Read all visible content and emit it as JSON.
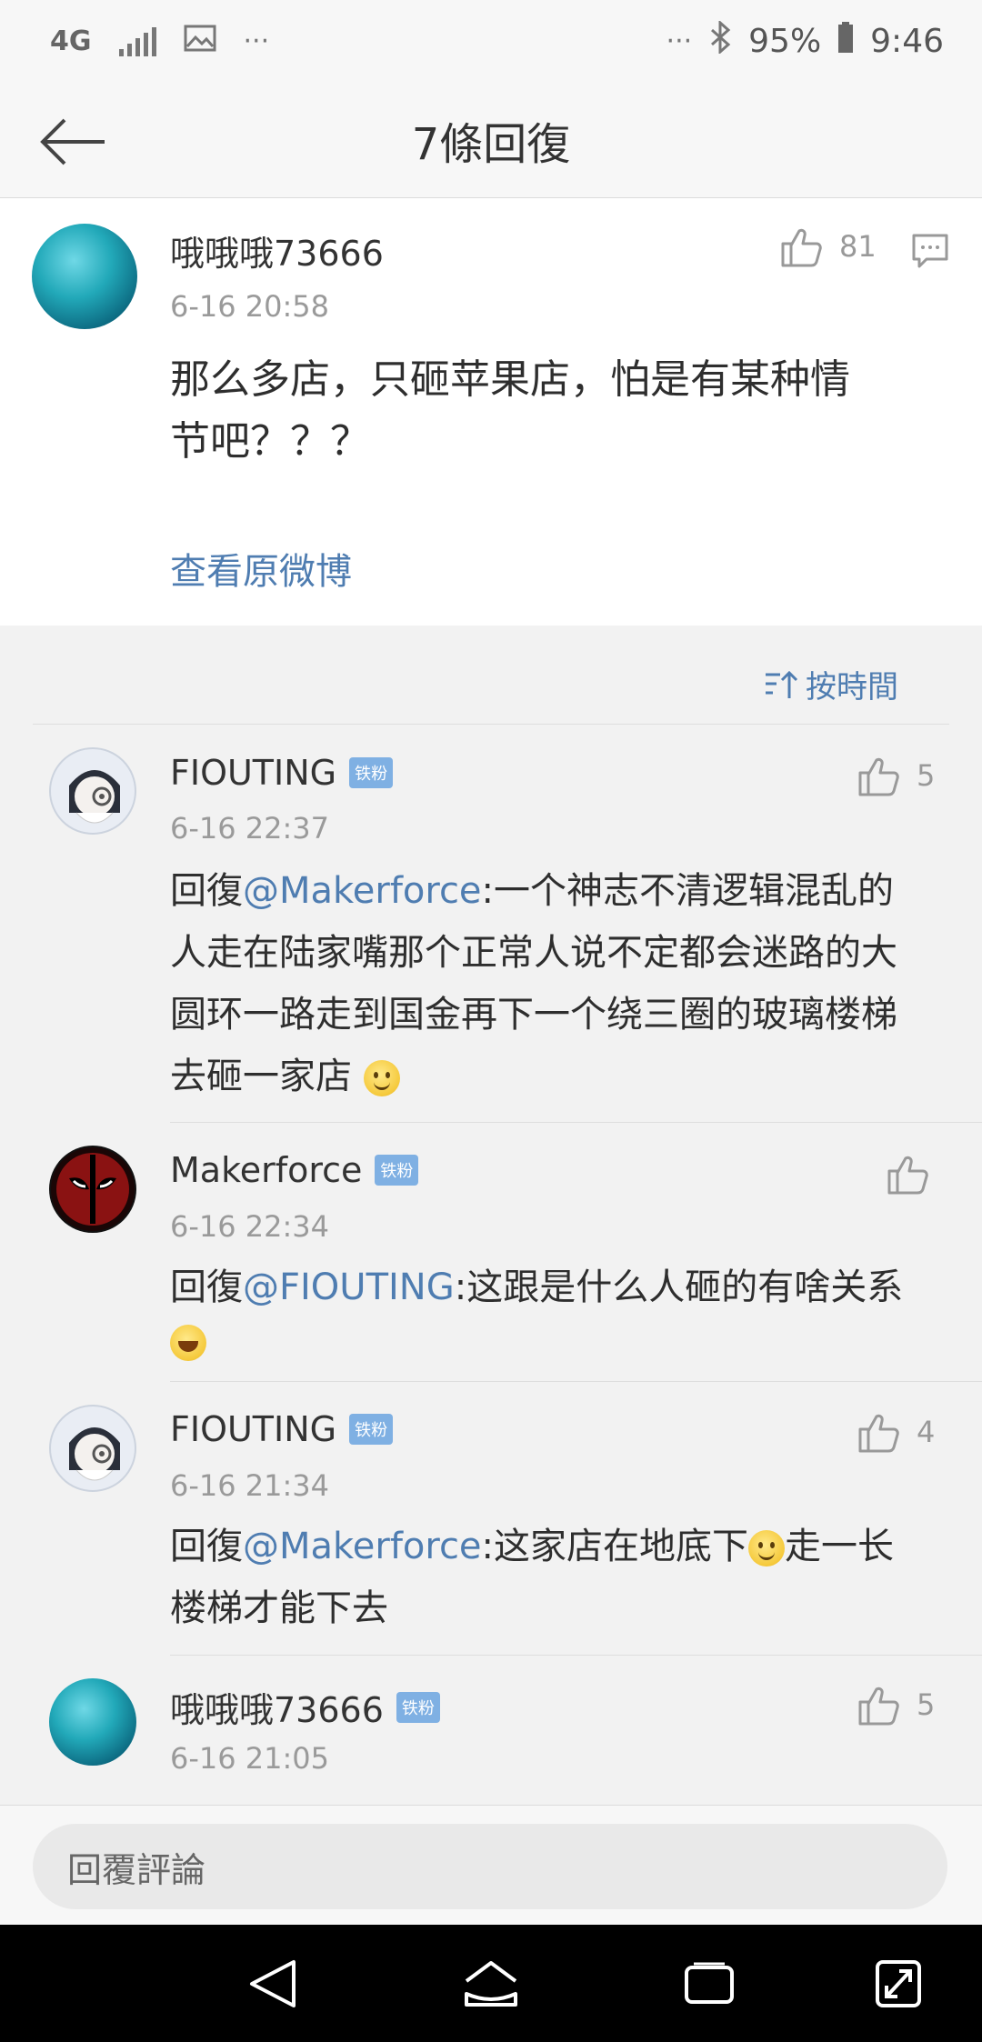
{
  "status_bar": {
    "network": "4G",
    "more": "···",
    "more_right": "···",
    "battery": "95%",
    "time": "9:46"
  },
  "header": {
    "title": "7條回復"
  },
  "main_comment": {
    "username": "哦哦哦73666",
    "time": "6-16 20:58",
    "likes": "81",
    "content_line1": "那么多店，只砸苹果店，怕是有某种情",
    "content_line2": "节吧？？？",
    "view_original": "查看原微博"
  },
  "sort": {
    "label": "按時間"
  },
  "replies": [
    {
      "username": "FIOUTING",
      "badge": "铁粉",
      "time": "6-16 22:37",
      "likes": "5",
      "prefix": "回復",
      "mention": "@Makerforce",
      "line1_rest": ":一个神志不清逻辑混乱的",
      "line2": "人走在陆家嘴那个正常人说不定都会迷路的大",
      "line3": "圆环一路走到国金再下一个绕三圈的玻璃楼梯",
      "line4": "去砸一家店"
    },
    {
      "username": "Makerforce",
      "badge": "铁粉",
      "time": "6-16 22:34",
      "likes": "",
      "prefix": "回復",
      "mention": "@FIOUTING",
      "line1_rest": ":这跟是什么人砸的有啥关系"
    },
    {
      "username": "FIOUTING",
      "badge": "铁粉",
      "time": "6-16 21:34",
      "likes": "4",
      "prefix": "回復",
      "mention": "@Makerforce",
      "line1_rest": ":这家店在地底下",
      "line1_after": "走一长",
      "line2": "楼梯才能下去"
    },
    {
      "username": "哦哦哦73666",
      "badge": "铁粉",
      "time": "6-16 21:05",
      "likes": "5"
    }
  ],
  "bottom": {
    "placeholder": "回覆評論"
  }
}
